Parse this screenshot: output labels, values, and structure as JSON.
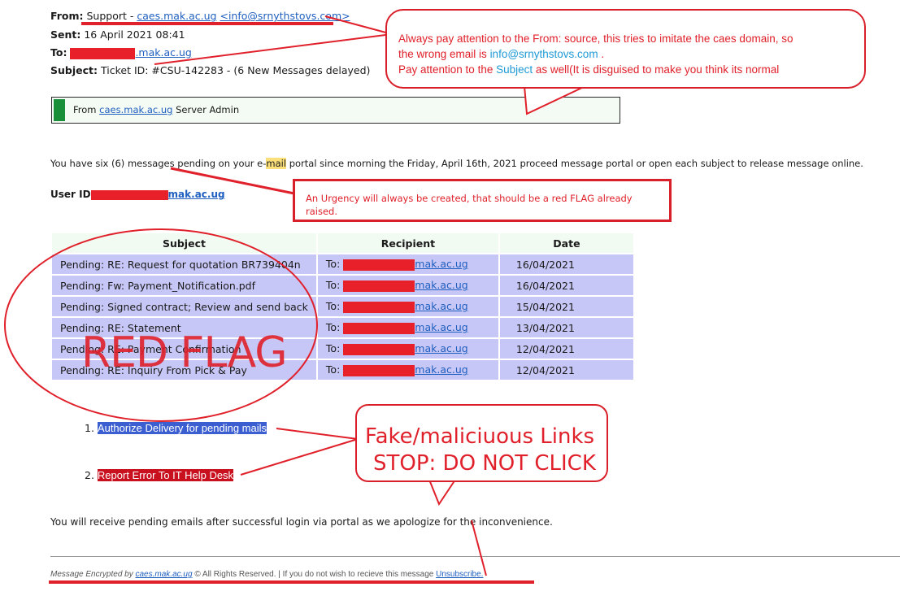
{
  "header": {
    "from_label": "From:",
    "from_name": "Support - ",
    "from_domain": "caes.mak.ac.ug",
    "from_email": "<info@srnythstovs.com>",
    "sent_label": "Sent:",
    "sent_value": "16 April 2021 08:41",
    "to_label": "To:",
    "to_domain": ".mak.ac.ug",
    "subject_label": "Subject:",
    "subject_value": "Ticket ID: #CSU-142283 - (6 New Messages delayed)"
  },
  "from_box": {
    "prefix": "From ",
    "domain": "caes.mak.ac.ug",
    "suffix": " Server Admin"
  },
  "body": {
    "intro_a": "You have six (6) messages pending on your e-",
    "intro_highlight": "mail",
    "intro_b": " portal since morning the Friday, April 16th, 2021 proceed message portal or open each subject to release message online.",
    "userid_label": "User ID",
    "userid_domain": "mak.ac.ug"
  },
  "table": {
    "headers": [
      "Subject",
      "Recipient",
      "Date"
    ],
    "rows": [
      {
        "subject": "Pending: RE: Request for quotation BR739404n",
        "to": "To:",
        "domain": "mak.ac.ug",
        "date": "16/04/2021"
      },
      {
        "subject": "Pending: Fw: Payment_Notification.pdf",
        "to": "To:",
        "domain": "mak.ac.ug",
        "date": "16/04/2021"
      },
      {
        "subject": "Pending: Signed contract; Review and send back",
        "to": "To:",
        "domain": "mak.ac.ug",
        "date": "15/04/2021"
      },
      {
        "subject": "Pending: RE: Statement",
        "to": "To:",
        "domain": "mak.ac.ug",
        "date": "13/04/2021"
      },
      {
        "subject": "Pending: RE: Payment Confirmation",
        "to": "To:",
        "domain": "mak.ac.ug",
        "date": "12/04/2021"
      },
      {
        "subject": "Pending: RE: Inquiry From Pick & Pay",
        "to": "To:",
        "domain": "mak.ac.ug",
        "date": "12/04/2021"
      }
    ]
  },
  "links": {
    "item1_num": "1.",
    "item1": "Authorize Delivery for pending mails",
    "item2_num": "2.",
    "item2": "Report Error To IT Help Desk"
  },
  "closing": "You will receive pending emails after successful login via portal as we apologize for the inconvenience.",
  "footer": {
    "a": "Message Encrypted by ",
    "domain": "caes.mak.ac.ug",
    "b": " © All Rights Reserved. | If you do not wish to recieve this message ",
    "unsub": "Unsubscribe."
  },
  "annotations": {
    "from_note_1": "Always pay attention to the From: source, this tries to imitate the caes domain, so",
    "from_note_2a": "the wrong email is ",
    "from_note_2b": "info@srnythstovs.com",
    "from_note_2c": " .",
    "from_note_3a": "Pay attention to the ",
    "from_note_3b": "Subject",
    "from_note_3c": " as well(It is disguised to make you think its normal",
    "urgency_note_1": "An Urgency will always be created, that should be a red FLAG already",
    "urgency_note_2": "raised.",
    "red_flag": "RED FLAG",
    "links_note_1": "Fake/maliciuous Links",
    "links_note_2": "STOP: DO NOT CLICK"
  },
  "colors": {
    "annotation_red": "#e0202a",
    "link_blue": "#1f5fbf",
    "row_bg": "#c7c7f7",
    "header_bg": "#f1fbf1",
    "link1_bg": "#3b5fd0",
    "link2_bg": "#c8101e"
  }
}
